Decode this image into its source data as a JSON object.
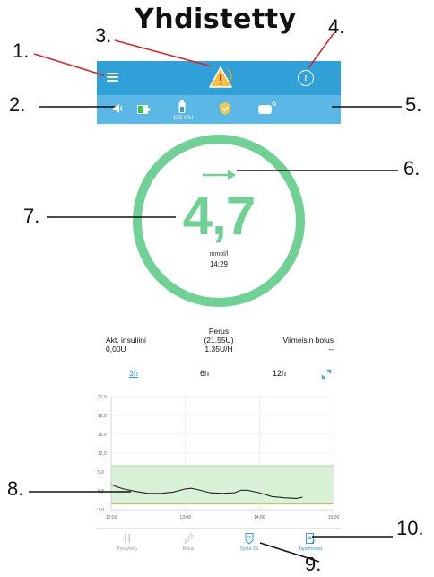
{
  "title": "Yhdistetty",
  "callouts": [
    "1.",
    "2.",
    "3.",
    "4.",
    "5.",
    "6.",
    "7.",
    "8.",
    "9.",
    "10."
  ],
  "app": {
    "colors": {
      "header": "#2fa0d8",
      "status_bar": "#5bb8e6",
      "glucose_green": "#6fd194",
      "accent_blue": "#2fa0d8"
    },
    "header": {
      "menu_icon": "hamburger-menu-icon",
      "alert_icon": "warning-triangle-icon",
      "info_icon": "info-circle-icon"
    },
    "status_bar": {
      "icons": [
        "speaker-vibrate-icon",
        "battery-icon",
        "insulin-cartridge-icon",
        "shield-check-icon",
        "cgm-transmitter-icon"
      ],
      "reservoir_label": "130.40U"
    },
    "glucose": {
      "value": "4,7",
      "unit": "mmol/l",
      "time": "14:29",
      "trend": "arrow-right-icon"
    },
    "insulin_info": {
      "active_label": "Akt. insuliini",
      "active_value": "0,00U",
      "basal_label": "Perus",
      "basal_total": "(21.55U)",
      "basal_rate": "1.35U/H",
      "last_bolus_label": "Viimeisin bolus",
      "last_bolus_value": "--"
    },
    "time_ranges": [
      {
        "label": "3h",
        "active": true
      },
      {
        "label": "6h",
        "active": false
      },
      {
        "label": "12h",
        "active": false
      }
    ],
    "expand_icon": "expand-arrows-icon",
    "bottom_nav": [
      {
        "label": "Pysäytetty",
        "icon": "pause-icon",
        "active": false
      },
      {
        "label": "Bolus",
        "icon": "pen-icon",
        "active": false
      },
      {
        "label": "Syötä VS",
        "icon": "glucose-drop-icon",
        "active": true
      },
      {
        "label": "Tapahtumat",
        "icon": "events-list-icon",
        "active": true
      }
    ]
  },
  "chart_data": {
    "type": "line",
    "x_ticks": [
      "12:00",
      "13:00",
      "14:00",
      "15:00"
    ],
    "y_ticks": [
      "21,0",
      "18,0",
      "15,0",
      "12,0",
      "9,0",
      "6,0",
      "3,0"
    ],
    "ylim": [
      3.0,
      21.0
    ],
    "target_range": [
      3.9,
      10.0
    ],
    "grid": true,
    "series": [
      {
        "x": [
          "12:00",
          "12:05",
          "12:10",
          "12:20",
          "12:30",
          "12:40",
          "12:50",
          "13:00",
          "13:05",
          "13:10",
          "13:20",
          "13:30",
          "13:40",
          "13:45",
          "13:50",
          "14:00",
          "14:10",
          "14:20",
          "14:30",
          "14:35"
        ],
        "values": [
          7.0,
          6.6,
          6.3,
          5.9,
          5.6,
          5.6,
          5.8,
          6.3,
          6.4,
          6.2,
          5.7,
          5.6,
          5.7,
          6.1,
          6.1,
          5.7,
          5.1,
          4.9,
          4.8,
          5.0
        ]
      }
    ]
  }
}
